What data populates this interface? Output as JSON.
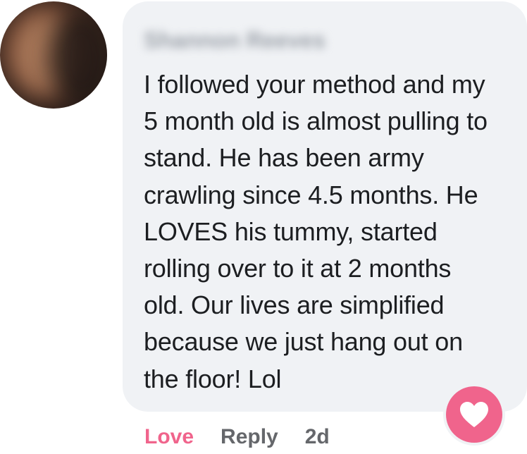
{
  "comment": {
    "author_name": "Shannon Reeves",
    "body": "I followed your method and my\n5 month old is almost pulling to\nstand. He has been army\ncrawling since 4.5 months. He\nLOVES his tummy, started\nrolling over to it at 2 months\nold. Our lives are simplified\nbecause we just hang out on\nthe floor! Lol",
    "reaction_icon": "heart-icon",
    "reaction_color": "#f0648c"
  },
  "actions": {
    "love_label": "Love",
    "reply_label": "Reply",
    "timestamp": "2d"
  }
}
